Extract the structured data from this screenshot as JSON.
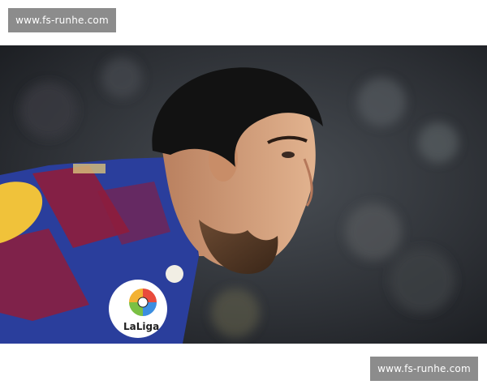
{
  "watermarks": {
    "top": "www.fs-runhe.com",
    "bottom": "www.fs-runhe.com"
  },
  "photo": {
    "description_icon": "football-player-photo",
    "kit_colors": {
      "blue": "#2a3e9c",
      "garnet": "#8e1d3c",
      "gold": "#f0c23a"
    },
    "badge_text": "LaLiga"
  }
}
